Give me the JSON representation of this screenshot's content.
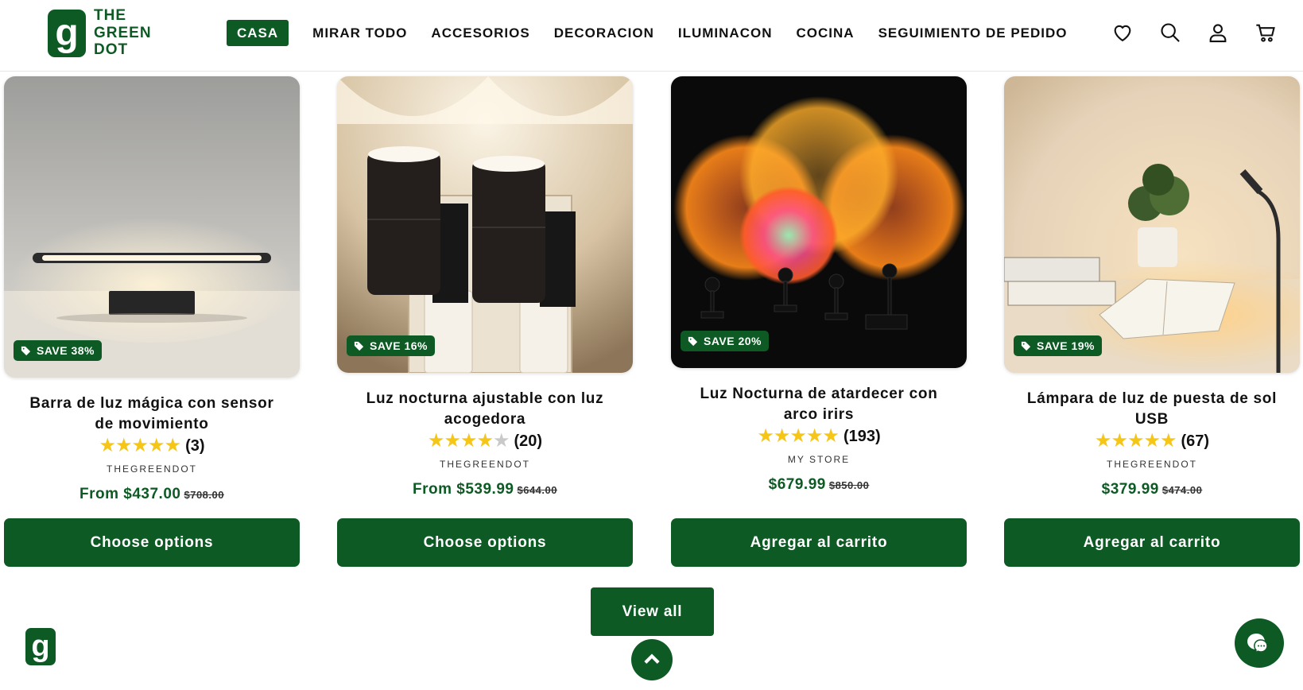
{
  "brand": {
    "logo_letter": "g",
    "line1": "THE",
    "line2": "GREEN",
    "line3": "DOT"
  },
  "nav": {
    "items": [
      {
        "label": "CASA",
        "active": true
      },
      {
        "label": "MIRAR TODO"
      },
      {
        "label": "ACCESORIOS"
      },
      {
        "label": "DECORACION"
      },
      {
        "label": "ILUMINACON"
      },
      {
        "label": "COCINA"
      },
      {
        "label": "SEGUIMIENTO DE PEDIDO"
      }
    ]
  },
  "header_icons": [
    "heart-icon",
    "search-icon",
    "account-icon",
    "cart-icon"
  ],
  "products": [
    {
      "badge": "SAVE 38%",
      "title": "Barra de luz mágica con sensor de movimiento",
      "stars": "★★★★★",
      "count": "(3)",
      "vendor": "THEGREENDOT",
      "price": "From $437.00",
      "old_price": "$708.00",
      "button": "Choose options"
    },
    {
      "badge": "SAVE 16%",
      "title": "Luz nocturna ajustable con luz acogedora",
      "stars": "★★★★",
      "stars_dim": "★",
      "count": "(20)",
      "vendor": "THEGREENDOT",
      "price": "From $539.99",
      "old_price": "$644.00",
      "button": "Choose options"
    },
    {
      "badge": "SAVE 20%",
      "title": "Luz Nocturna de atardecer con arco irirs",
      "stars": "★★★★★",
      "count": "(193)",
      "vendor": "MY STORE",
      "price": "$679.99",
      "old_price": "$850.00",
      "button": "Agregar al carrito"
    },
    {
      "badge": "SAVE 19%",
      "title": "Lámpara de luz de puesta de sol USB",
      "stars": "★★★★★",
      "count": "(67)",
      "vendor": "THEGREENDOT",
      "price": "$379.99",
      "old_price": "$474.00",
      "button": "Agregar al carrito"
    }
  ],
  "view_all": "View all",
  "floating": {
    "logo_letter": "g"
  },
  "colors": {
    "brand_green": "#0d5a24",
    "star": "#f5c518"
  }
}
